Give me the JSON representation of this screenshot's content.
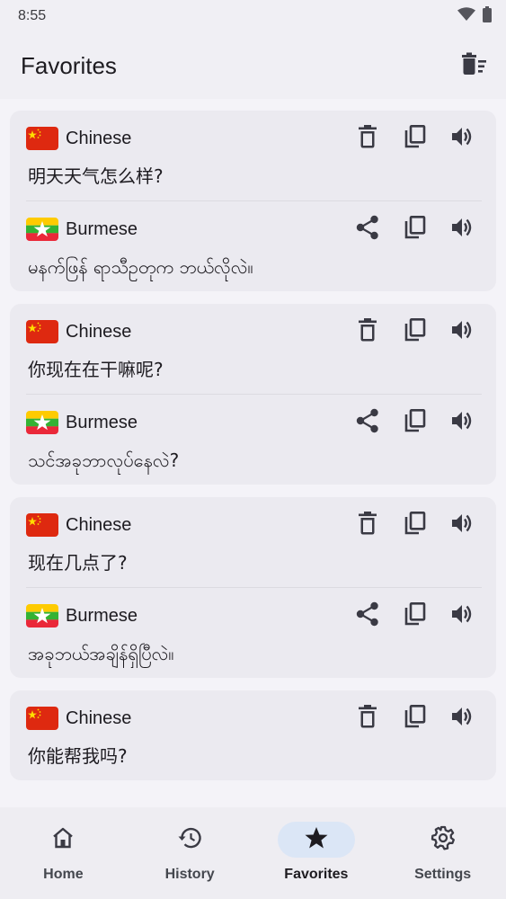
{
  "status_bar": {
    "time": "8:55"
  },
  "app_bar": {
    "title": "Favorites",
    "action_icon": "delete-sweep-icon"
  },
  "favorites": [
    {
      "source": {
        "language": "Chinese",
        "flag": "china-flag",
        "text": "明天天气怎么样?"
      },
      "target": {
        "language": "Burmese",
        "flag": "myanmar-flag",
        "text": "မနက်ဖြန် ရာသီဥတုက ဘယ်လိုလဲ။"
      }
    },
    {
      "source": {
        "language": "Chinese",
        "flag": "china-flag",
        "text": "你现在在干嘛呢?"
      },
      "target": {
        "language": "Burmese",
        "flag": "myanmar-flag",
        "text": "သင်အခုဘာလုပ်နေလဲ?"
      }
    },
    {
      "source": {
        "language": "Chinese",
        "flag": "china-flag",
        "text": "现在几点了?"
      },
      "target": {
        "language": "Burmese",
        "flag": "myanmar-flag",
        "text": "အခုဘယ်အချိန်ရှိပြီလဲ။"
      }
    },
    {
      "source": {
        "language": "Chinese",
        "flag": "china-flag",
        "text": "你能帮我吗?"
      }
    }
  ],
  "bottom_nav": {
    "items": [
      {
        "label": "Home",
        "icon": "home-icon",
        "active": false
      },
      {
        "label": "History",
        "icon": "history-icon",
        "active": false
      },
      {
        "label": "Favorites",
        "icon": "star-icon",
        "active": true
      },
      {
        "label": "Settings",
        "icon": "gear-icon",
        "active": false
      }
    ]
  },
  "colors": {
    "background": "#f4f3f8",
    "card": "#ebeaf0",
    "active_pill": "#dbe6f6",
    "icon": "#3a3a44"
  }
}
